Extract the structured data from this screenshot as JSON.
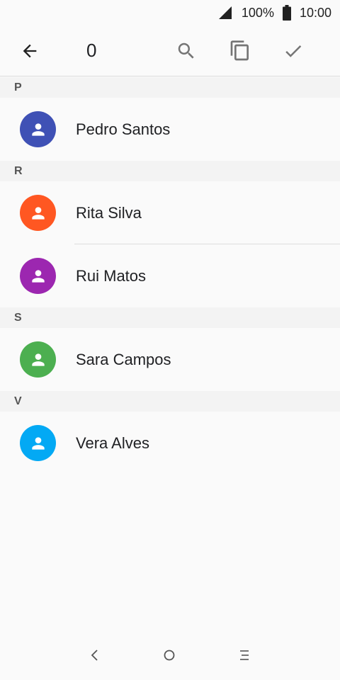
{
  "status_bar": {
    "battery_percent": "100%",
    "time": "10:00",
    "icons": [
      "signal-icon",
      "battery-icon"
    ]
  },
  "toolbar": {
    "selected_count": "0",
    "icons": [
      "back-arrow-icon",
      "search-icon",
      "select-all-icon",
      "check-icon"
    ]
  },
  "sections": [
    {
      "letter": "P",
      "contacts": [
        {
          "name": "Pedro Santos",
          "color": "#3f51b5"
        }
      ]
    },
    {
      "letter": "R",
      "contacts": [
        {
          "name": "Rita Silva",
          "color": "#ff5722"
        },
        {
          "name": "Rui Matos",
          "color": "#9c27b0"
        }
      ]
    },
    {
      "letter": "S",
      "contacts": [
        {
          "name": "Sara Campos",
          "color": "#4caf50"
        }
      ]
    },
    {
      "letter": "V",
      "contacts": [
        {
          "name": "Vera Alves",
          "color": "#03a9f4"
        }
      ]
    }
  ],
  "nav_bar": {
    "icons": [
      "nav-back-icon",
      "nav-home-icon",
      "nav-recent-icon"
    ]
  }
}
